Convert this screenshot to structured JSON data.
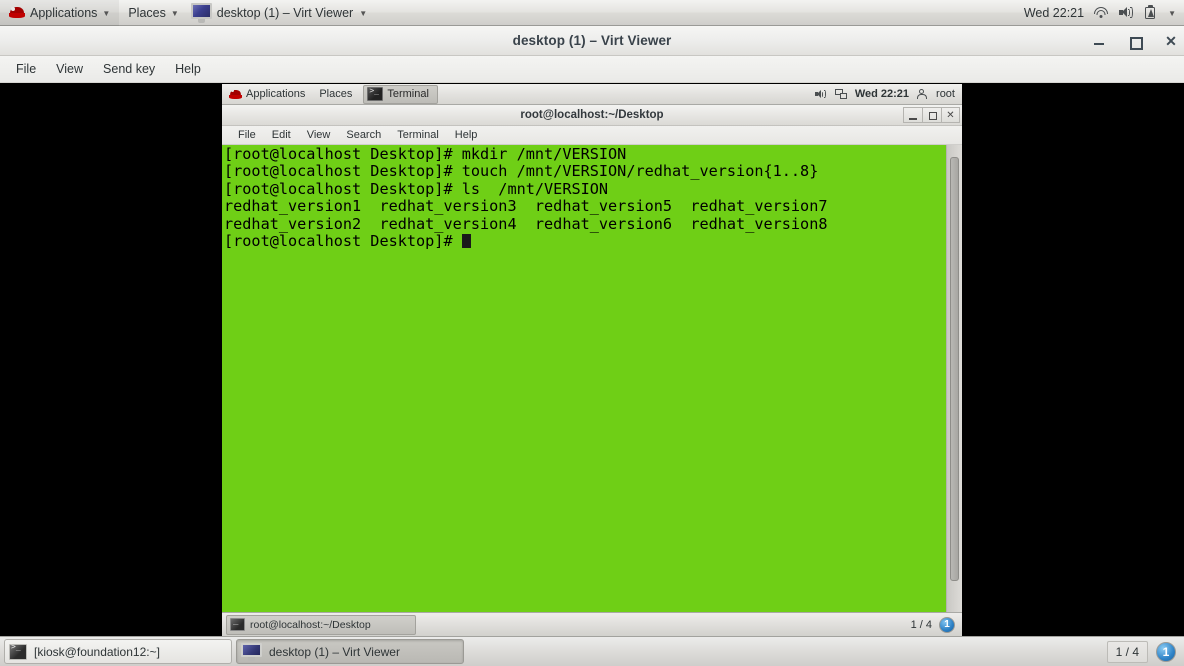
{
  "host_panel": {
    "logo_icon": "redhat-logo-icon",
    "applications_label": "Applications",
    "places_label": "Places",
    "window_tab_label": "desktop (1) – Virt Viewer",
    "window_tab_icon": "monitor-icon",
    "clock": "Wed 22:21",
    "tray_icons": [
      "wifi-icon",
      "volume-icon",
      "battery-icon",
      "chevron-down-icon"
    ]
  },
  "virt_viewer": {
    "title": "desktop (1) – Virt Viewer",
    "menu": [
      "File",
      "View",
      "Send key",
      "Help"
    ],
    "window_buttons": {
      "minimize": "minimize-button",
      "maximize": "maximize-button",
      "close": "✕"
    }
  },
  "guest_panel": {
    "logo_icon": "redhat-logo-icon",
    "applications_label": "Applications",
    "places_label": "Places",
    "task_label": "Terminal",
    "task_icon": "terminal-icon",
    "clock": "Wed 22:21",
    "user_label": "root",
    "tray_icons": [
      "volume-icon",
      "network-icon",
      "user-icon"
    ]
  },
  "terminal_window": {
    "title": "root@localhost:~/Desktop",
    "menu": [
      "File",
      "Edit",
      "View",
      "Search",
      "Terminal",
      "Help"
    ],
    "window_buttons": {
      "minimize": "minimize-button",
      "maximize": "maximize-button",
      "close": "✕"
    },
    "content": "[root@localhost Desktop]# mkdir /mnt/VERSION\n[root@localhost Desktop]# touch /mnt/VERSION/redhat_version{1..8}\n[root@localhost Desktop]# ls  /mnt/VERSION\nredhat_version1  redhat_version3  redhat_version5  redhat_version7\nredhat_version2  redhat_version4  redhat_version6  redhat_version8\n[root@localhost Desktop]# ",
    "lines": [
      "[root@localhost Desktop]# mkdir /mnt/VERSION",
      "[root@localhost Desktop]# touch /mnt/VERSION/redhat_version{1..8}",
      "[root@localhost Desktop]# ls  /mnt/VERSION",
      "redhat_version1  redhat_version3  redhat_version5  redhat_version7",
      "redhat_version2  redhat_version4  redhat_version6  redhat_version8",
      "[root@localhost Desktop]# "
    ],
    "background_color": "#6fcf16",
    "foreground_color": "#000000"
  },
  "guest_taskbar": {
    "window_button_label": "root@localhost:~/Desktop",
    "window_button_icon": "terminal-icon",
    "pager_label": "1 / 4",
    "workspace_badge": "1"
  },
  "host_taskbar": {
    "button1_label": "[kiosk@foundation12:~]",
    "button1_icon": "terminal-icon",
    "button2_label": "desktop (1) – Virt Viewer",
    "button2_icon": "monitor-icon",
    "pager_label": "1 / 4",
    "workspace_badge": "1"
  }
}
